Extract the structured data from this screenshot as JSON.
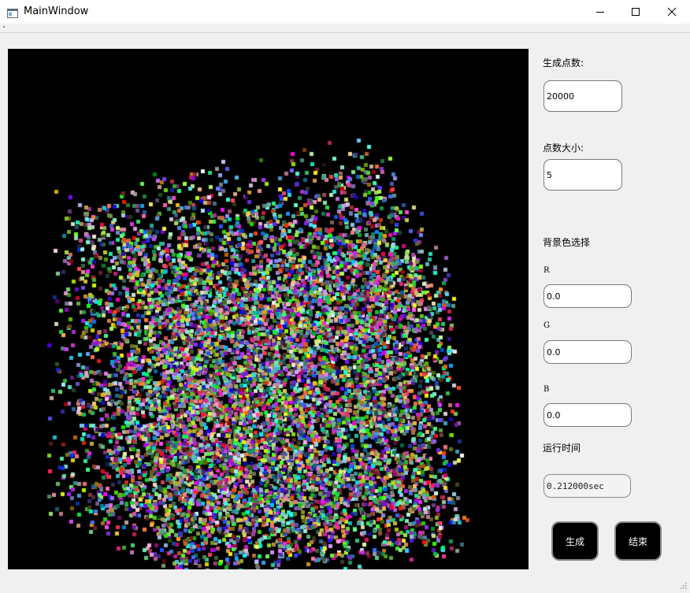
{
  "window": {
    "title": "MainWindow"
  },
  "icons": {
    "app": "window-icon",
    "minimize": "minimize-icon",
    "maximize": "maximize-icon",
    "close": "close-icon",
    "resize": "resize-grip-icon"
  },
  "viewport": {
    "background": "#000000"
  },
  "panel": {
    "point_count_label": "生成点数:",
    "point_count_value": "20000",
    "point_size_label": "点数大小:",
    "point_size_value": "5",
    "bg_color_label": "背景色选择",
    "r_label": "R",
    "r_value": "0.0",
    "g_label": "G",
    "g_value": "0.0",
    "b_label": "B",
    "b_value": "0.0",
    "runtime_label": "运行时间",
    "runtime_value": "0.212000sec",
    "generate_label": "生成",
    "end_label": "结束"
  }
}
